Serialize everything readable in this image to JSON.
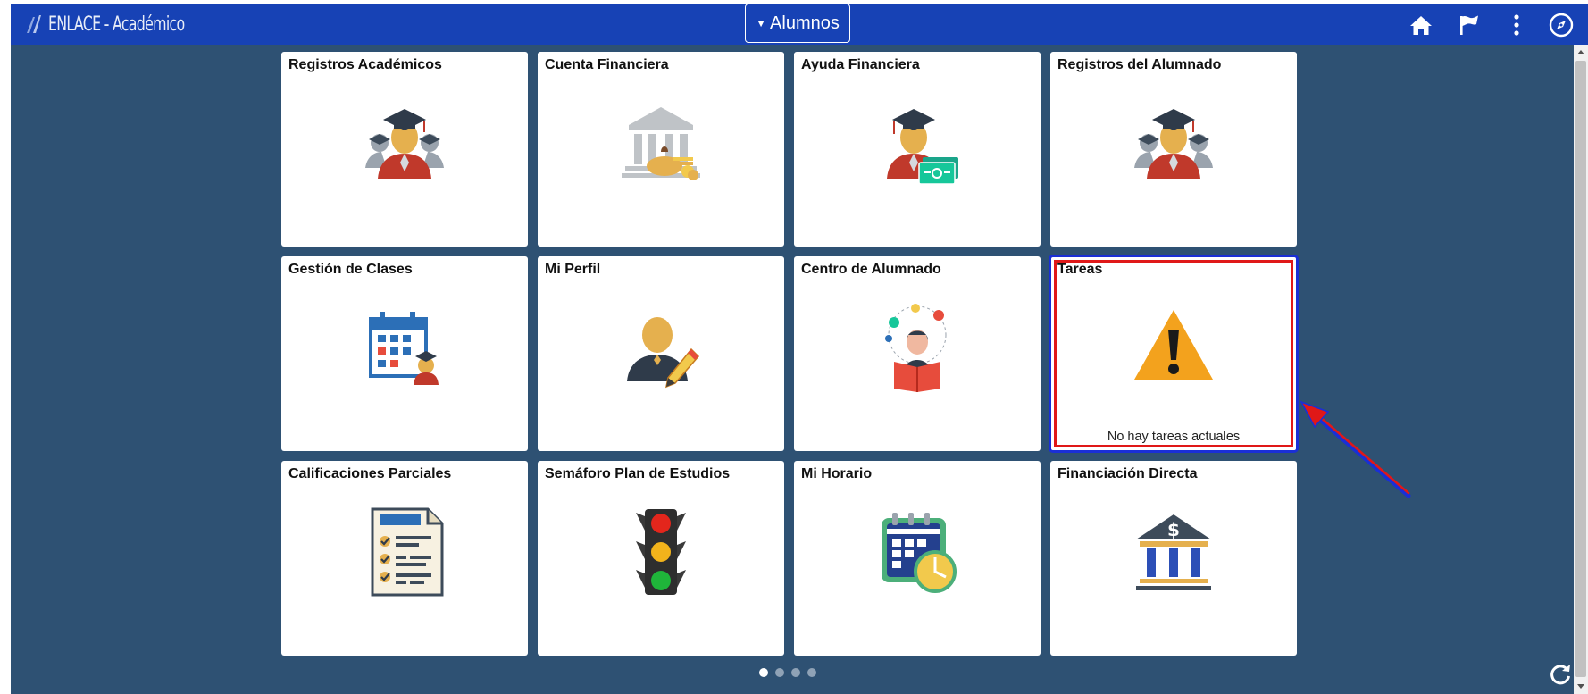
{
  "header": {
    "logo_text": "ENLACE - Académico",
    "homepage_selector": "Alumnos"
  },
  "tiles": [
    {
      "title": "Registros Académicos",
      "icon": "student-group-icon"
    },
    {
      "title": "Cuenta Financiera",
      "icon": "bank-coins-icon"
    },
    {
      "title": "Ayuda Financiera",
      "icon": "graduate-money-icon"
    },
    {
      "title": "Registros del Alumnado",
      "icon": "student-group-icon"
    },
    {
      "title": "Gestión de Clases",
      "icon": "calendar-student-icon"
    },
    {
      "title": "Mi Perfil",
      "icon": "user-edit-icon"
    },
    {
      "title": "Centro de Alumnado",
      "icon": "student-reading-icon"
    },
    {
      "title": "Tareas",
      "icon": "warning-icon",
      "caption": "No hay tareas actuales"
    },
    {
      "title": "Calificaciones Parciales",
      "icon": "checklist-icon"
    },
    {
      "title": "Semáforo Plan de Estudios",
      "icon": "traffic-light-icon"
    },
    {
      "title": "Mi Horario",
      "icon": "calendar-clock-icon"
    },
    {
      "title": "Financiación Directa",
      "icon": "bank-dollar-icon"
    }
  ],
  "pagination": {
    "pages": 4,
    "current": 1
  },
  "colors": {
    "header": "#1742b5",
    "background": "#2e5173",
    "highlight_outer": "#1a2fd6",
    "highlight_inner": "#e01818"
  }
}
